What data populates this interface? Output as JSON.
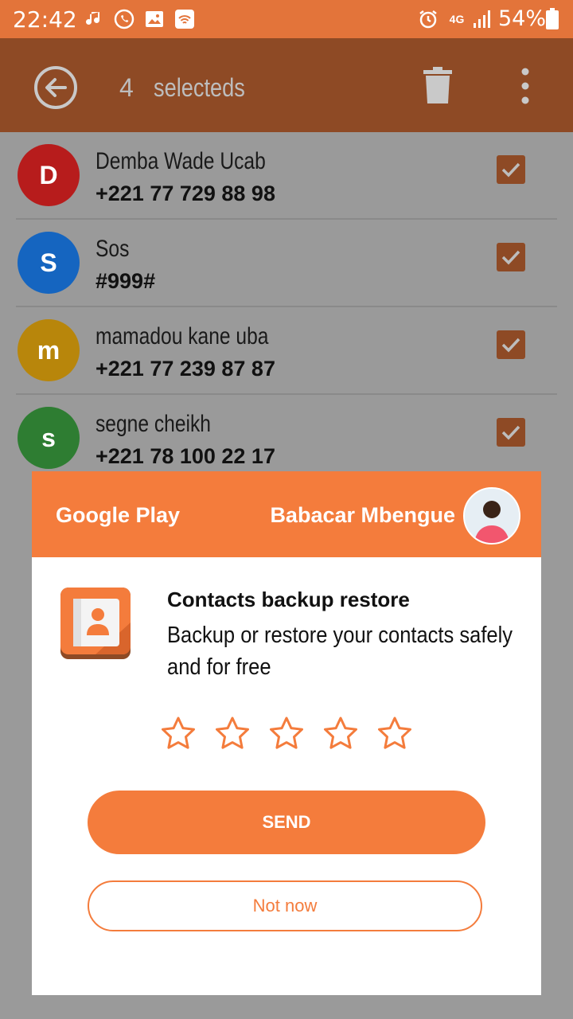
{
  "status_bar": {
    "time": "22:42",
    "network": "4G",
    "battery": "54%",
    "battery_level": "7"
  },
  "app_bar": {
    "selected_count": "4",
    "selected_label": "selecteds"
  },
  "contacts": [
    {
      "initial": "D",
      "name": "Demba Wade Ucab",
      "phone": "+221 77 729 88 98",
      "color": "#b71c1c",
      "checked": true
    },
    {
      "initial": "S",
      "name": "Sos",
      "phone": "#999#",
      "color": "#1565c0",
      "checked": true
    },
    {
      "initial": "m",
      "name": "mamadou kane uba",
      "phone": "+221 77 239 87 87",
      "color": "#b8860b",
      "checked": true
    },
    {
      "initial": "s",
      "name": "segne cheikh",
      "phone": "+221 78 100 22 17",
      "color": "#2e7d32",
      "checked": true
    }
  ],
  "dialog": {
    "store_name": "Google Play",
    "user_name": "Babacar Mbengue",
    "app_title": "Contacts backup restore",
    "app_description": "Backup or restore your contacts  safely and for free",
    "rating": 0,
    "rating_max": 5,
    "send_label": "SEND",
    "not_now_label": "Not now"
  },
  "colors": {
    "accent": "#f47c3c",
    "status_bar": "#e3743a",
    "app_bar": "#8e4a25"
  }
}
